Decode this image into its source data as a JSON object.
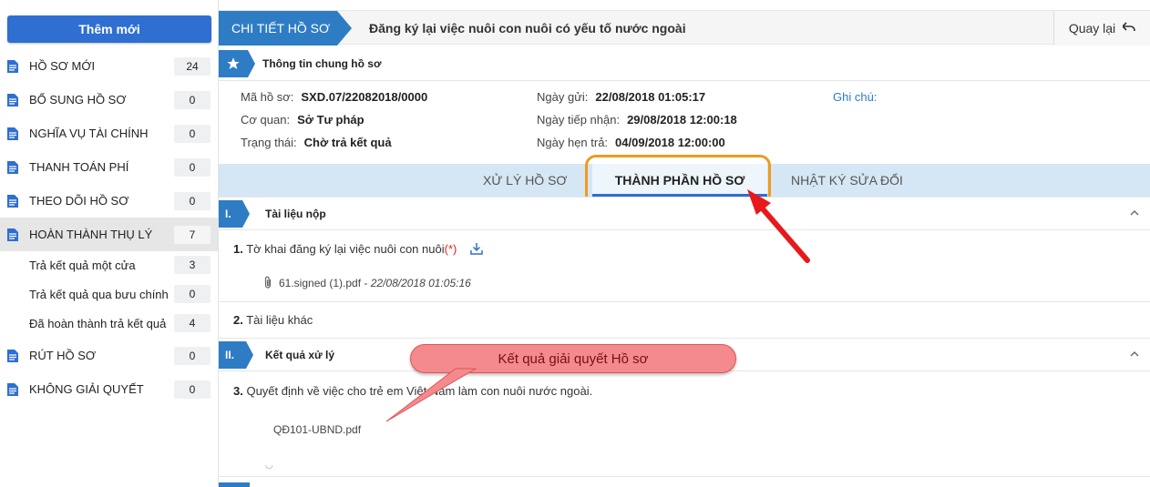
{
  "sidebar": {
    "new_button": "Thêm mới",
    "items": [
      {
        "label": "HỒ SƠ MỚI",
        "count": "24"
      },
      {
        "label": "BỔ SUNG HỒ SƠ",
        "count": "0"
      },
      {
        "label": "NGHĨA VỤ TÀI CHÍNH",
        "count": "0"
      },
      {
        "label": "THANH TOÁN PHÍ",
        "count": "0"
      },
      {
        "label": "THEO DÕI HỒ SƠ",
        "count": "0"
      },
      {
        "label": "HOÀN THÀNH THỤ LÝ",
        "count": "7"
      },
      {
        "label": "Trả kết quả một cửa",
        "count": "3"
      },
      {
        "label": "Trả kết quả qua bưu chính",
        "count": "0"
      },
      {
        "label": "Đã hoàn thành trả kết quả",
        "count": "4"
      },
      {
        "label": "RÚT HỒ SƠ",
        "count": "0"
      },
      {
        "label": "KHÔNG GIẢI QUYẾT",
        "count": "0"
      }
    ]
  },
  "header": {
    "breadcrumb": "CHI TIẾT HỒ SƠ",
    "title": "Đăng ký lại việc nuôi con nuôi có yếu tố nước ngoài",
    "back_label": "Quay lại"
  },
  "general": {
    "section_title": "Thông tin chung hồ sơ",
    "ma_ho_so_label": "Mã hồ sơ:",
    "ma_ho_so": "SXD.07/22082018/0000",
    "co_quan_label": "Cơ quan:",
    "co_quan": "Sở Tư pháp",
    "trang_thai_label": "Trạng thái:",
    "trang_thai": "Chờ trả kết quả",
    "ngay_gui_label": "Ngày gửi:",
    "ngay_gui": "22/08/2018 01:05:17",
    "ngay_tiep_nhan_label": "Ngày tiếp nhận:",
    "ngay_tiep_nhan": "29/08/2018 12:00:18",
    "ngay_hen_tra_label": "Ngày hẹn trả:",
    "ngay_hen_tra": "04/09/2018 12:00:00",
    "ghi_chu_label": "Ghi chú:"
  },
  "tabs": [
    {
      "label": "XỬ LÝ HỒ SƠ"
    },
    {
      "label": "THÀNH PHẦN HỒ SƠ"
    },
    {
      "label": "NHẬT KÝ SỬA ĐỔI"
    }
  ],
  "section1": {
    "roman": "I.",
    "title": "Tài liệu nộp",
    "item1_num": "1.",
    "item1_text": "Tờ khai đăng ký lại việc nuôi con nuôi",
    "item1_req": "(*)",
    "file_name": "61.signed (1).pdf",
    "file_sep": " - ",
    "file_date": "22/08/2018 01:05:16",
    "item2_num": "2.",
    "item2_text": "Tài liệu khác"
  },
  "section2": {
    "roman": "II.",
    "title": "Kết quả xử lý",
    "item3_num": "3.",
    "item3_text": "Quyết định về việc cho trẻ em Việt Nam làm con nuôi nước ngoài.",
    "file_name": "QĐ101-UBND.pdf"
  },
  "annotation": {
    "callout_text": "Kết quả giải quyết Hồ sơ"
  },
  "colors": {
    "primary": "#2e7cc4",
    "button": "#2e6fd1",
    "highlight": "#f09a1c",
    "arrow": "#e8191c",
    "callout": "#f48a8e"
  }
}
